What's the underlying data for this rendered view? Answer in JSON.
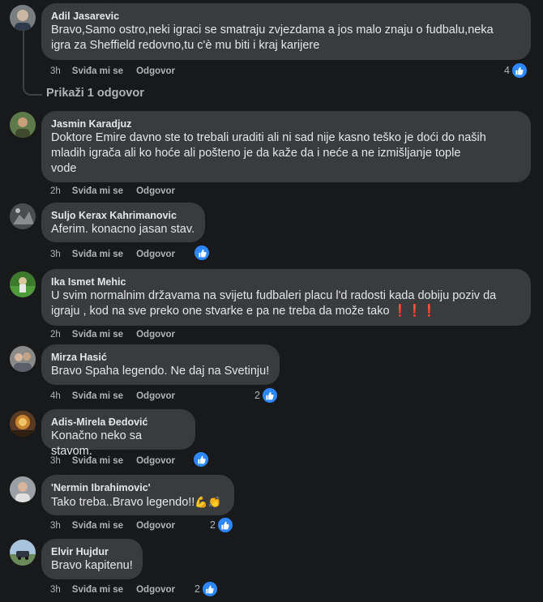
{
  "labels": {
    "like": "Sviđa mi se",
    "reply": "Odgovor"
  },
  "show_replies": "Prikaži 1 odgovor",
  "comments": [
    {
      "author": "Adil Jasarevic",
      "lines": [
        "Bravo,Samo ostro,neki igraci se smatraju zvjezdama a jos malo znaju o fudbalu,neka",
        "igra za Sheffield redovno,tu c'è mu biti i kraj karijere"
      ],
      "time": "3h",
      "reaction_icon": "like-icon",
      "reaction_count": "4"
    },
    {
      "author": "Jasmin Karadjuz",
      "lines": [
        "Doktore Emire davno ste to trebali uraditi ali ni sad nije kasno teško je doći do naših",
        "mladih igrača ali ko hoće ali pošteno je da kaže da i neće a ne izmišljanje tople",
        "vode"
      ],
      "time": "2h",
      "reaction_icon": "",
      "reaction_count": ""
    },
    {
      "author": "Suljo Kerax Kahrimanovic",
      "lines": [
        "Aferim. konacno jasan stav."
      ],
      "time": "3h",
      "reaction_icon": "like-icon",
      "reaction_count": ""
    },
    {
      "author": "Ika Ismet Mehic",
      "lines": [
        "U svim normalnim državama na svijetu fudbaleri placu l'd radosti kada dobiju poziv da",
        "igraju , kod na sve preko one stvarke e pa ne treba da može tako"
      ],
      "extra_emoji": "❗❗❗",
      "time": "2h",
      "reaction_icon": "",
      "reaction_count": ""
    },
    {
      "author": "Mirza Hasić",
      "lines": [
        "Bravo Spaha legendo. Ne daj na Svetinju!"
      ],
      "time": "4h",
      "reaction_icon": "like-icon",
      "reaction_count": "2"
    },
    {
      "author": "Adis-Mirela Đedović",
      "lines": [
        "Konačno neko sa stavom."
      ],
      "time": "3h",
      "reaction_icon": "like-icon",
      "reaction_count": ""
    },
    {
      "author": "'Nermin Ibrahimovic'",
      "lines": [
        "Tako treba..Bravo legendo!!"
      ],
      "extra_emoji": "💪👏",
      "time": "3h",
      "reaction_icon": "like-icon",
      "reaction_count": "2"
    },
    {
      "author": "Elvir Hujdur",
      "lines": [
        "Bravo kapitenu!"
      ],
      "time": "3h",
      "reaction_icon": "like-icon",
      "reaction_count": "2"
    }
  ]
}
